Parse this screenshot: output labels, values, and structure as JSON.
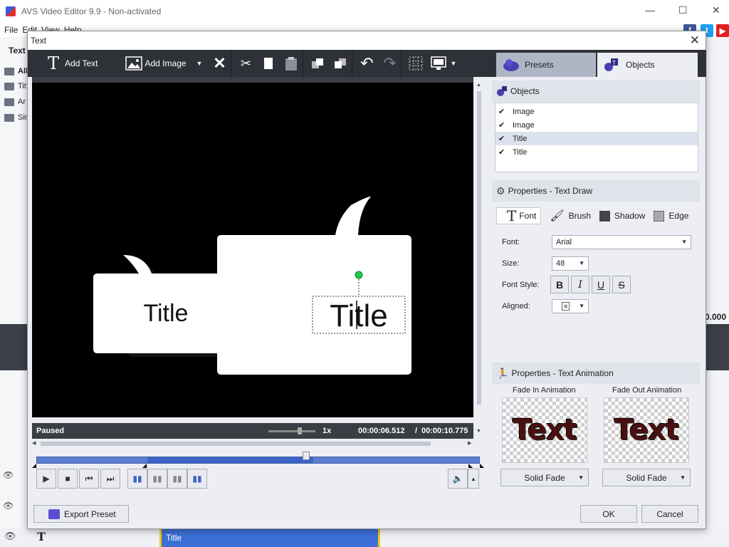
{
  "app": {
    "window_title": "AVS Video Editor 9.9 - Non-activated",
    "menu": [
      "File",
      "Edit",
      "View",
      "Help"
    ],
    "left_panel_label": "Text",
    "left_items": [
      "All",
      "Tit",
      "Ar",
      "Sin"
    ],
    "time_fragment": "0.000",
    "timeline_clip_label": "Title"
  },
  "dialog": {
    "title": "Text",
    "toolbar": {
      "add_text": "Add Text",
      "add_image": "Add Image"
    },
    "tabs": {
      "presets": "Presets",
      "objects": "Objects"
    },
    "preview": {
      "status": "Paused",
      "speed": "1x",
      "current_time": "00:00:06.512",
      "time_sep": "/",
      "total_time": "00:00:10.775",
      "bubble_small_text": "Title",
      "bubble_large_text": "Title"
    },
    "objects_panel": {
      "header": "Objects",
      "items": [
        {
          "label": "Image",
          "checked": true,
          "selected": false
        },
        {
          "label": "Image",
          "checked": true,
          "selected": false
        },
        {
          "label": "Title",
          "checked": true,
          "selected": true
        },
        {
          "label": "Title",
          "checked": true,
          "selected": false
        }
      ]
    },
    "text_draw": {
      "header": "Properties - Text Draw",
      "tabs": {
        "font": "Font",
        "brush": "Brush",
        "shadow": "Shadow",
        "edge": "Edge"
      },
      "font_label": "Font:",
      "font_value": "Arial",
      "size_label": "Size:",
      "size_value": "48",
      "style_label": "Font Style:",
      "aligned_label": "Aligned:"
    },
    "text_animation": {
      "header": "Properties - Text Animation",
      "fade_in_label": "Fade In Animation",
      "fade_out_label": "Fade Out Animation",
      "preview_text": "Text",
      "fade_in_value": "Solid Fade",
      "fade_out_value": "Solid Fade"
    },
    "buttons": {
      "export": "Export Preset",
      "ok": "OK",
      "cancel": "Cancel"
    }
  },
  "colors": {
    "toolbar_bg": "#2e3138",
    "seek_blue": "#5b7fcf",
    "handle_green": "#1ec94a"
  }
}
